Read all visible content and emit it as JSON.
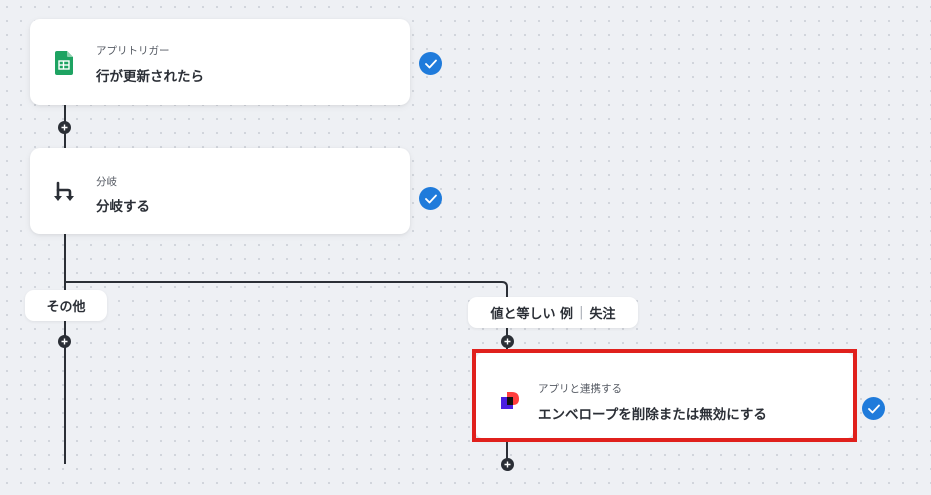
{
  "steps": [
    {
      "label": "アプリトリガー",
      "title": "行が更新されたら",
      "icon": "google-sheets-icon"
    },
    {
      "label": "分岐",
      "title": "分岐する",
      "icon": "branch-icon"
    },
    {
      "label": "アプリと連携する",
      "title": "エンベロープを削除または無効にする",
      "icon": "docusign-app-icon"
    }
  ],
  "branches": {
    "other_label": "その他",
    "equals_label": "値と等しい 例",
    "equals_value": "失注"
  },
  "colors": {
    "check": "#1f7bdb",
    "connector": "#2b2f36",
    "highlight": "#e0201c",
    "sheets_green": "#1ea362"
  }
}
